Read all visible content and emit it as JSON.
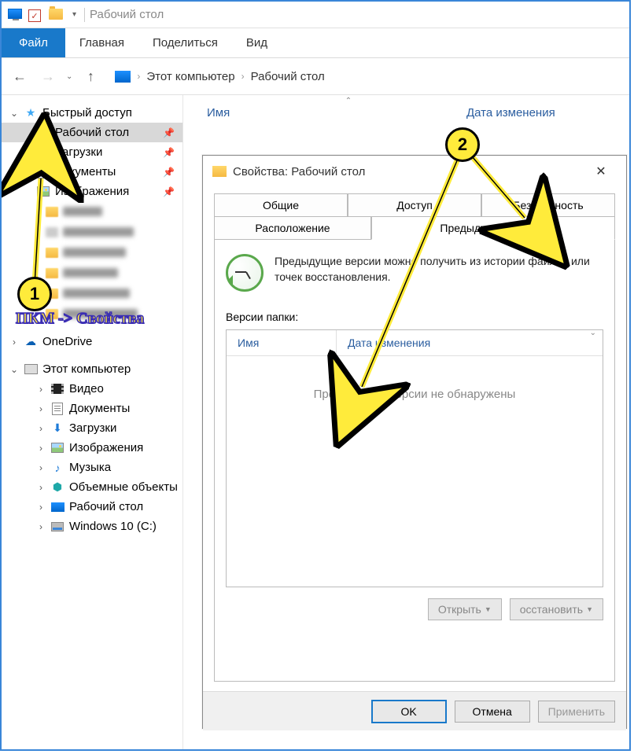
{
  "window": {
    "title": "Рабочий стол"
  },
  "ribbon": {
    "file": "Файл",
    "home": "Главная",
    "share": "Поделиться",
    "view": "Вид"
  },
  "breadcrumb": {
    "item1": "Этот компьютер",
    "item2": "Рабочий стол"
  },
  "columns": {
    "name": "Имя",
    "date": "Дата изменения"
  },
  "sidebar": {
    "quick": "Быстрый доступ",
    "desktop": "Рабочий стол",
    "downloads": "Загрузки",
    "documents": "Документы",
    "pictures": "Изображения",
    "onedrive": "OneDrive",
    "thispc": "Этот компьютер",
    "videos": "Видео",
    "documents2": "Документы",
    "downloads2": "Загрузки",
    "pictures2": "Изображения",
    "music": "Музыка",
    "objects3d": "Объемные объекты",
    "desktop2": "Рабочий стол",
    "cdrive": "Windows 10 (C:)"
  },
  "dialog": {
    "title": "Свойства: Рабочий стол",
    "tabs": {
      "general": "Общие",
      "sharing": "Доступ",
      "security": "Безопасность",
      "location": "Расположение",
      "previous": "Предыдущие версии"
    },
    "desc": "Предыдущие версии можно получить из истории файлов или точек восстановления.",
    "versions_label": "Версии папки:",
    "col_name": "Имя",
    "col_date": "Дата изменения",
    "empty": "Предыдущие версии не обнаружены",
    "open_btn": "Открыть",
    "restore_btn": "осстановить",
    "ok": "OK",
    "cancel": "Отмена",
    "apply": "Применить"
  },
  "annotations": {
    "badge1": "1",
    "badge2": "2",
    "hint": "ПКМ -> Свойства"
  }
}
